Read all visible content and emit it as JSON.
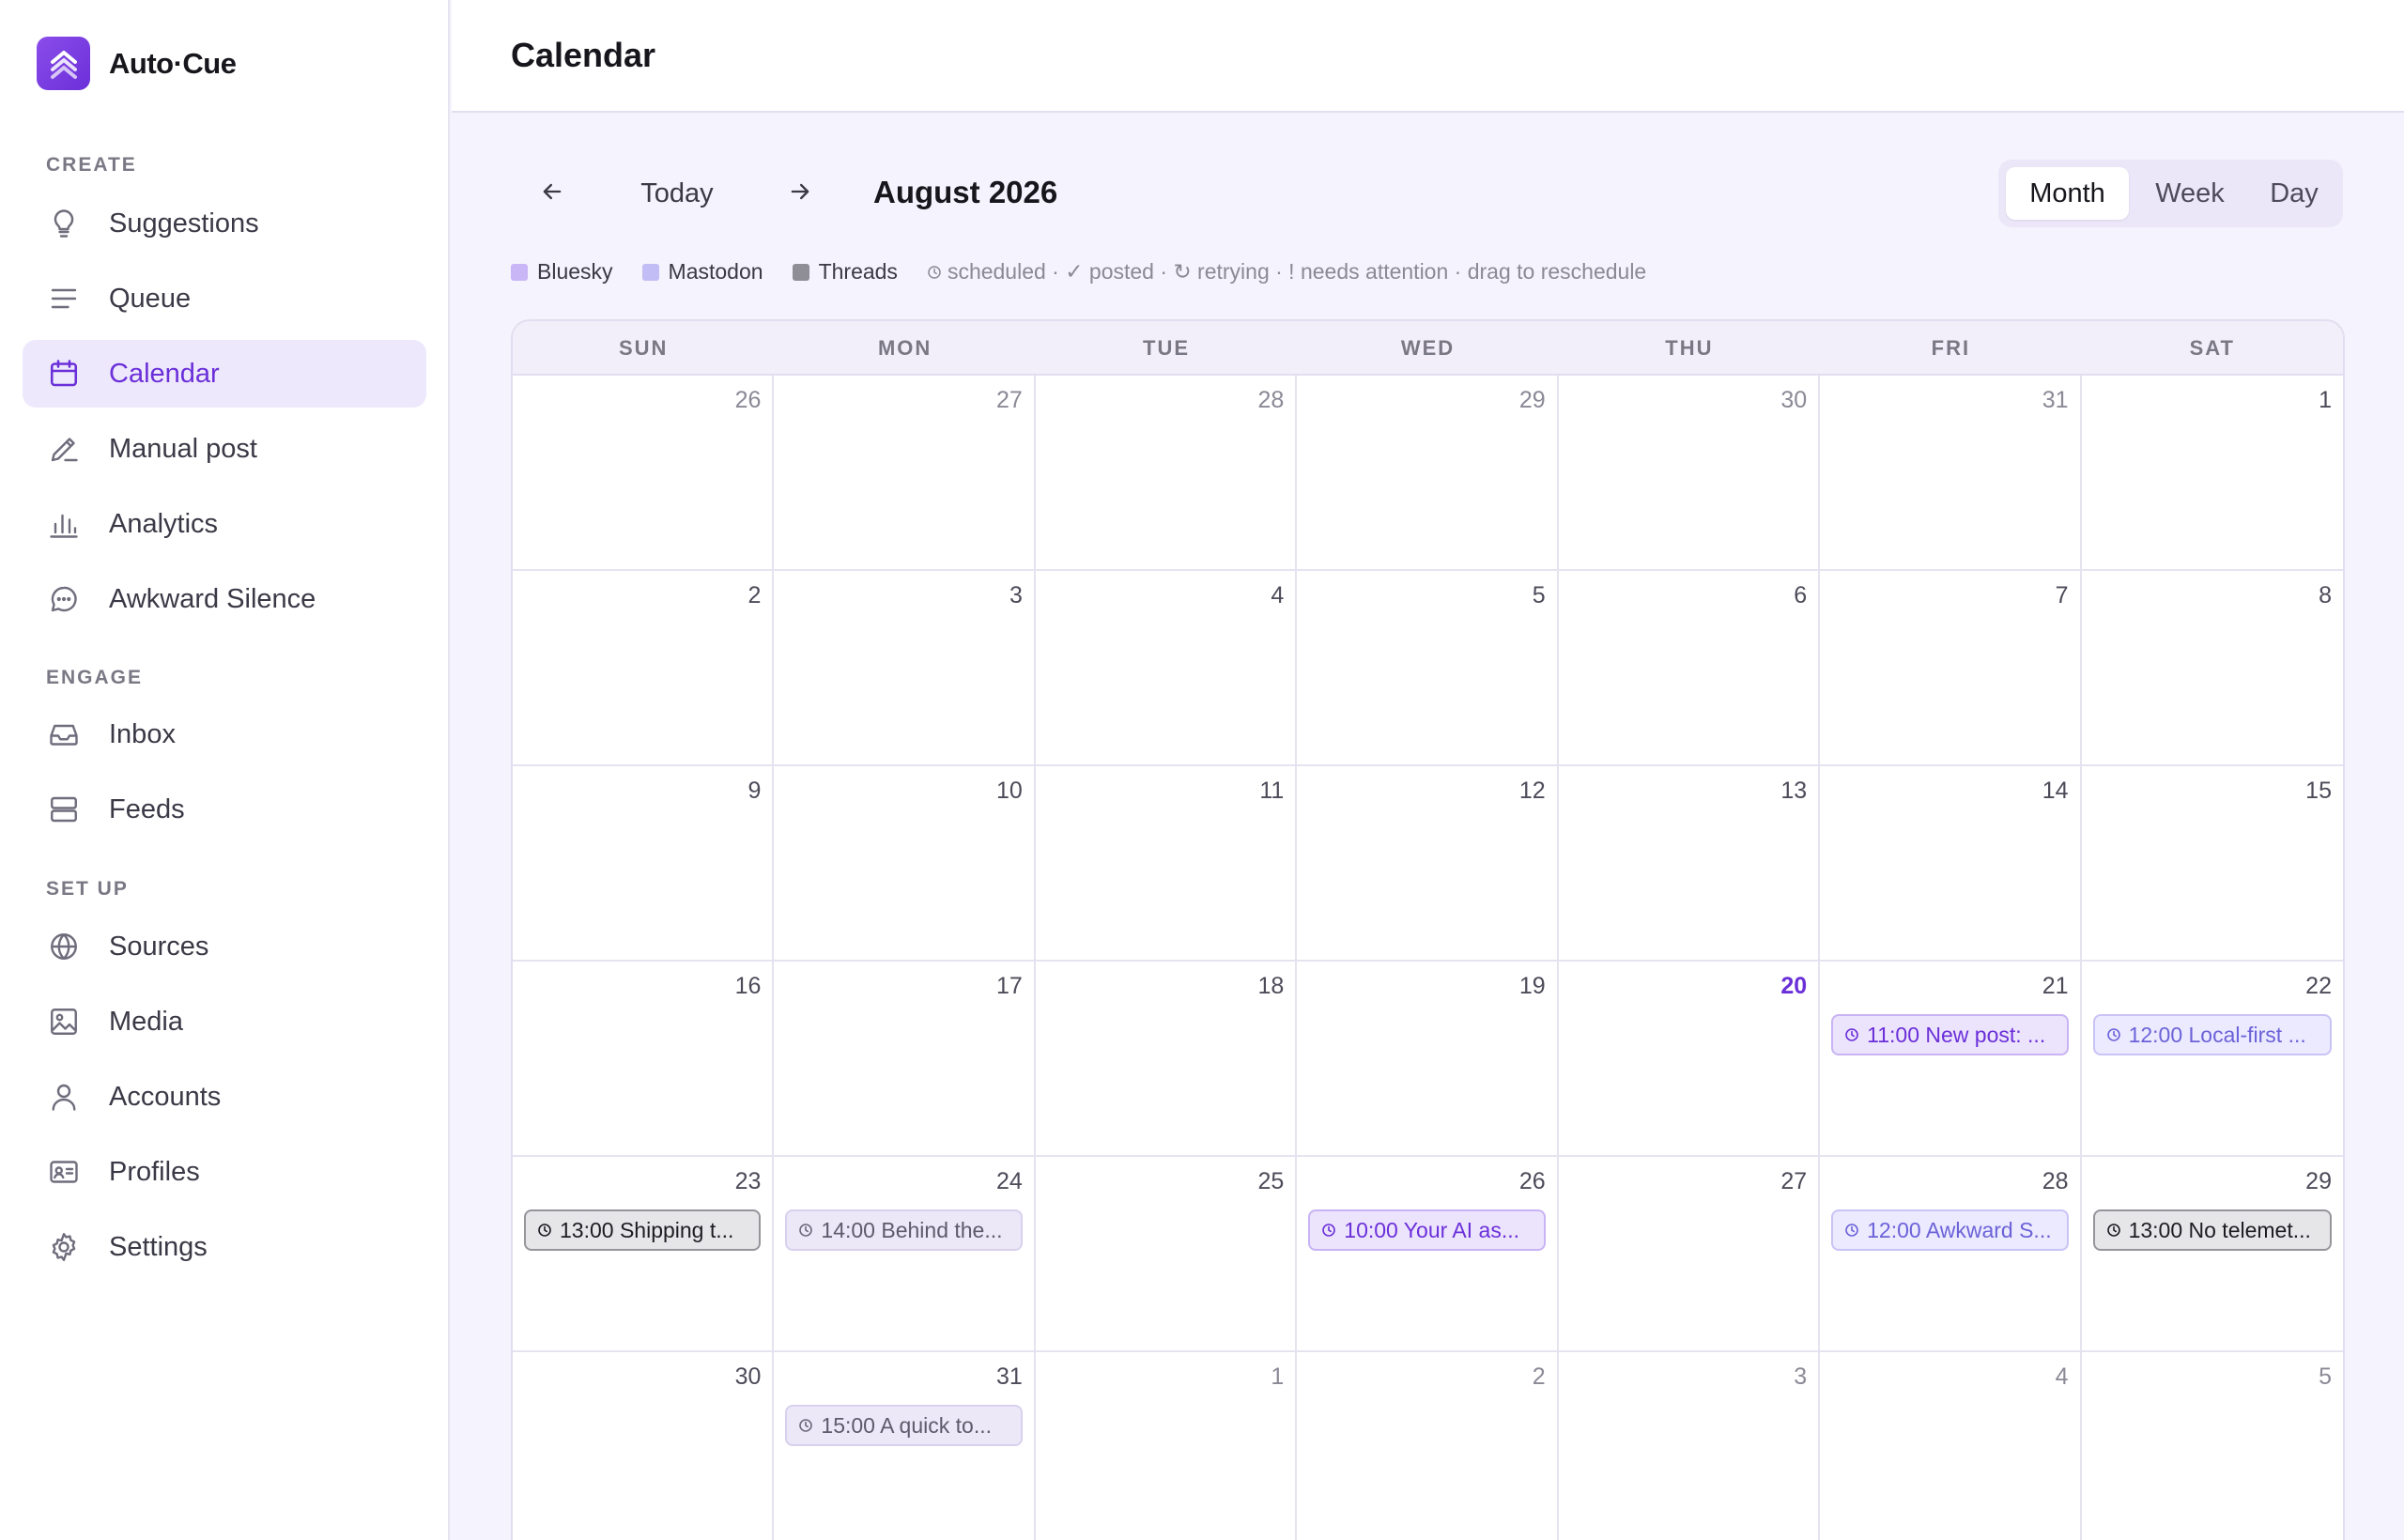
{
  "app": {
    "name": "Auto·Cue"
  },
  "sidebar": {
    "sections": [
      {
        "label": "CREATE"
      },
      {
        "label": "ENGAGE"
      },
      {
        "label": "SET UP"
      }
    ],
    "items": [
      {
        "label": "Suggestions",
        "icon": "lightbulb-icon"
      },
      {
        "label": "Queue",
        "icon": "queue-lines-icon"
      },
      {
        "label": "Calendar",
        "icon": "calendar-icon",
        "active": true
      },
      {
        "label": "Manual post",
        "icon": "pencil-icon"
      },
      {
        "label": "Analytics",
        "icon": "bar-chart-icon"
      },
      {
        "label": "Awkward Silence",
        "icon": "chat-bubble-icon"
      },
      {
        "label": "Inbox",
        "icon": "inbox-icon"
      },
      {
        "label": "Feeds",
        "icon": "feeds-icon"
      },
      {
        "label": "Sources",
        "icon": "globe-icon"
      },
      {
        "label": "Media",
        "icon": "image-icon"
      },
      {
        "label": "Accounts",
        "icon": "user-icon"
      },
      {
        "label": "Profiles",
        "icon": "id-card-icon"
      },
      {
        "label": "Settings",
        "icon": "gear-icon"
      }
    ]
  },
  "header": {
    "title": "Calendar"
  },
  "toolbar": {
    "prev_icon": "arrow-left-icon",
    "today_label": "Today",
    "next_icon": "arrow-right-icon",
    "month_label": "August 2026",
    "views": [
      "Month",
      "Week",
      "Day"
    ],
    "active_view": "Month"
  },
  "legend": {
    "platforms": [
      {
        "label": "Bluesky",
        "color": "#c9b6f7"
      },
      {
        "label": "Mastodon",
        "color": "#c3bdf5"
      },
      {
        "label": "Threads",
        "color": "#8f8e96"
      }
    ],
    "status_note": "scheduled · ✓ posted · ↻ retrying · ! needs attention · drag to reschedule"
  },
  "calendar": {
    "weekdays": [
      "SUN",
      "MON",
      "TUE",
      "WED",
      "THU",
      "FRI",
      "SAT"
    ],
    "weeks": [
      [
        {
          "day": "26",
          "other": true
        },
        {
          "day": "27",
          "other": true
        },
        {
          "day": "28",
          "other": true
        },
        {
          "day": "29",
          "other": true
        },
        {
          "day": "30",
          "other": true
        },
        {
          "day": "31",
          "other": true
        },
        {
          "day": "1"
        }
      ],
      [
        {
          "day": "2"
        },
        {
          "day": "3"
        },
        {
          "day": "4"
        },
        {
          "day": "5"
        },
        {
          "day": "6"
        },
        {
          "day": "7"
        },
        {
          "day": "8"
        }
      ],
      [
        {
          "day": "9"
        },
        {
          "day": "10"
        },
        {
          "day": "11"
        },
        {
          "day": "12"
        },
        {
          "day": "13"
        },
        {
          "day": "14"
        },
        {
          "day": "15"
        }
      ],
      [
        {
          "day": "16"
        },
        {
          "day": "17"
        },
        {
          "day": "18"
        },
        {
          "day": "19"
        },
        {
          "day": "20",
          "today": true
        },
        {
          "day": "21",
          "event": {
            "text": "11:00 New post: ...",
            "platform": "bluesky"
          }
        },
        {
          "day": "22",
          "event": {
            "text": "12:00 Local-first ...",
            "platform": "mastodon"
          }
        }
      ],
      [
        {
          "day": "23",
          "event": {
            "text": "13:00 Shipping t...",
            "platform": "threads"
          }
        },
        {
          "day": "24",
          "event": {
            "text": "14:00 Behind the...",
            "platform": "muted"
          }
        },
        {
          "day": "25"
        },
        {
          "day": "26",
          "event": {
            "text": "10:00 Your AI as...",
            "platform": "bluesky"
          }
        },
        {
          "day": "27"
        },
        {
          "day": "28",
          "event": {
            "text": "12:00 Awkward S...",
            "platform": "mastodon"
          }
        },
        {
          "day": "29",
          "event": {
            "text": "13:00 No telemet...",
            "platform": "threads"
          }
        }
      ],
      [
        {
          "day": "30"
        },
        {
          "day": "31",
          "event": {
            "text": "15:00 A quick to...",
            "platform": "muted"
          }
        },
        {
          "day": "1",
          "other": true
        },
        {
          "day": "2",
          "other": true
        },
        {
          "day": "3",
          "other": true
        },
        {
          "day": "4",
          "other": true
        },
        {
          "day": "5",
          "other": true
        }
      ]
    ]
  }
}
